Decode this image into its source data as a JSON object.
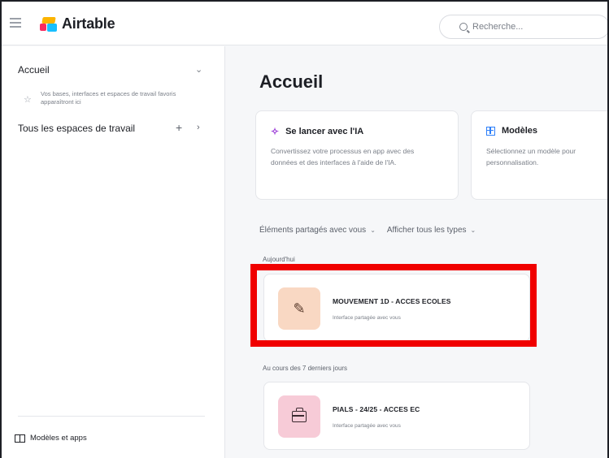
{
  "app": {
    "name": "Airtable"
  },
  "search": {
    "placeholder": "Recherche..."
  },
  "sidebar": {
    "home_label": "Accueil",
    "home_hint": "Vos bases, interfaces et espaces de travail favoris apparaîtront ici",
    "workspaces_label": "Tous les espaces de travail",
    "models_apps_label": "Modèles et apps"
  },
  "main": {
    "title": "Accueil",
    "cards": [
      {
        "title": "Se lancer avec l'IA",
        "description": "Convertissez votre processus en app avec des données et des interfaces à l'aide de l'IA.",
        "icon": "sparkle-icon"
      },
      {
        "title": "Modèles",
        "description": "Sélectionnez un modèle pour personnalisation.",
        "icon": "grid-icon"
      }
    ],
    "filters": {
      "shared": "Éléments partagés avec vous",
      "types": "Afficher tous les types"
    },
    "sections": [
      {
        "label": "Aujourd'hui",
        "items": [
          {
            "title": "MOUVEMENT 1D - ACCES ECOLES",
            "subtitle": "Interface partagée avec vous",
            "icon": "pencil-icon",
            "color": "#f9d8c3"
          }
        ]
      },
      {
        "label": "Au cours des 7 derniers jours",
        "items": [
          {
            "title": "PIALS - 24/25 - ACCES EC",
            "subtitle": "Interface partagée avec vous",
            "icon": "briefcase-icon",
            "color": "#f7cbd7"
          }
        ]
      }
    ]
  },
  "colors": {
    "highlight": "#f00000",
    "accent_blue": "#2d7ff9",
    "accent_purple": "#9b3bd8"
  }
}
